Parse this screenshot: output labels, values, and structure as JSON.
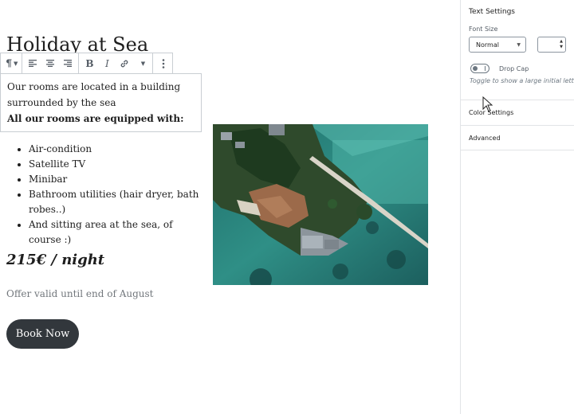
{
  "post": {
    "title": "Holiday at Sea",
    "intro_line_1": "Our rooms are located in a building",
    "intro_line_2": "surrounded by the sea",
    "intro_strong": "All our rooms are equipped with:",
    "amenities": [
      "Air-condition",
      "Satellite TV",
      "Minibar",
      "Bathroom utilities (hair dryer, bath robes..)",
      "And sitting area at the sea, of course :)"
    ],
    "price": "215€ / night",
    "offer": "Offer valid until end of August",
    "button_label": "Book Now",
    "image_icon": "aerial-island-photo"
  },
  "toolbar": {
    "icons": [
      "paragraph-icon",
      "align-left-icon",
      "align-center-icon",
      "align-right-icon",
      "bold-icon",
      "italic-icon",
      "link-icon",
      "more-options-icon"
    ],
    "bold_label": "B",
    "italic_label": "I"
  },
  "sidebar": {
    "text_settings_title": "Text Settings",
    "font_size_label": "Font Size",
    "font_size_value": "Normal",
    "font_size_custom": "",
    "drop_cap_label": "Drop Cap",
    "drop_cap_on": false,
    "drop_cap_help": "Toggle to show a large initial letter.",
    "sections": [
      "Color Settings",
      "Advanced"
    ]
  },
  "colors": {
    "button_bg": "#32373c",
    "muted_text": "#72777c",
    "border": "#c9ced3"
  }
}
